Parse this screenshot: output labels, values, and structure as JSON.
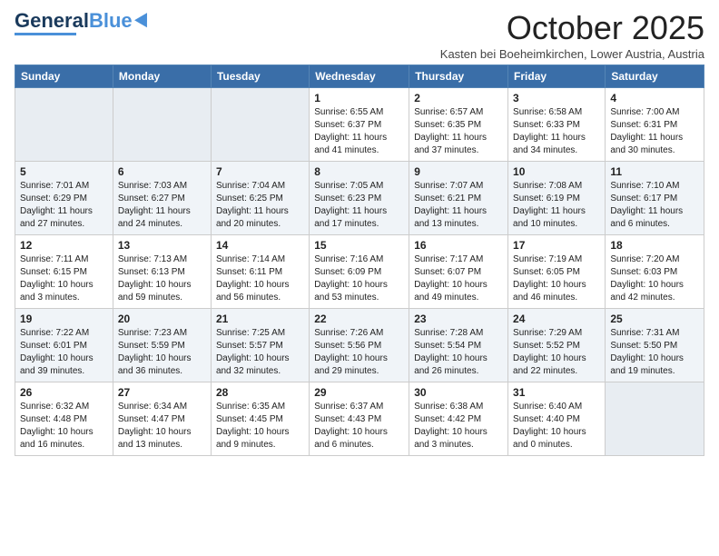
{
  "header": {
    "logo_general": "General",
    "logo_blue": "Blue",
    "month_title": "October 2025",
    "subtitle": "Kasten bei Boeheimkirchen, Lower Austria, Austria"
  },
  "days_of_week": [
    "Sunday",
    "Monday",
    "Tuesday",
    "Wednesday",
    "Thursday",
    "Friday",
    "Saturday"
  ],
  "weeks": [
    [
      {
        "day": "",
        "empty": true
      },
      {
        "day": "",
        "empty": true
      },
      {
        "day": "",
        "empty": true
      },
      {
        "day": "1",
        "sunrise": "6:55 AM",
        "sunset": "6:37 PM",
        "daylight": "11 hours and 41 minutes."
      },
      {
        "day": "2",
        "sunrise": "6:57 AM",
        "sunset": "6:35 PM",
        "daylight": "11 hours and 37 minutes."
      },
      {
        "day": "3",
        "sunrise": "6:58 AM",
        "sunset": "6:33 PM",
        "daylight": "11 hours and 34 minutes."
      },
      {
        "day": "4",
        "sunrise": "7:00 AM",
        "sunset": "6:31 PM",
        "daylight": "11 hours and 30 minutes."
      }
    ],
    [
      {
        "day": "5",
        "sunrise": "7:01 AM",
        "sunset": "6:29 PM",
        "daylight": "11 hours and 27 minutes."
      },
      {
        "day": "6",
        "sunrise": "7:03 AM",
        "sunset": "6:27 PM",
        "daylight": "11 hours and 24 minutes."
      },
      {
        "day": "7",
        "sunrise": "7:04 AM",
        "sunset": "6:25 PM",
        "daylight": "11 hours and 20 minutes."
      },
      {
        "day": "8",
        "sunrise": "7:05 AM",
        "sunset": "6:23 PM",
        "daylight": "11 hours and 17 minutes."
      },
      {
        "day": "9",
        "sunrise": "7:07 AM",
        "sunset": "6:21 PM",
        "daylight": "11 hours and 13 minutes."
      },
      {
        "day": "10",
        "sunrise": "7:08 AM",
        "sunset": "6:19 PM",
        "daylight": "11 hours and 10 minutes."
      },
      {
        "day": "11",
        "sunrise": "7:10 AM",
        "sunset": "6:17 PM",
        "daylight": "11 hours and 6 minutes."
      }
    ],
    [
      {
        "day": "12",
        "sunrise": "7:11 AM",
        "sunset": "6:15 PM",
        "daylight": "10 hours and 3 minutes."
      },
      {
        "day": "13",
        "sunrise": "7:13 AM",
        "sunset": "6:13 PM",
        "daylight": "10 hours and 59 minutes."
      },
      {
        "day": "14",
        "sunrise": "7:14 AM",
        "sunset": "6:11 PM",
        "daylight": "10 hours and 56 minutes."
      },
      {
        "day": "15",
        "sunrise": "7:16 AM",
        "sunset": "6:09 PM",
        "daylight": "10 hours and 53 minutes."
      },
      {
        "day": "16",
        "sunrise": "7:17 AM",
        "sunset": "6:07 PM",
        "daylight": "10 hours and 49 minutes."
      },
      {
        "day": "17",
        "sunrise": "7:19 AM",
        "sunset": "6:05 PM",
        "daylight": "10 hours and 46 minutes."
      },
      {
        "day": "18",
        "sunrise": "7:20 AM",
        "sunset": "6:03 PM",
        "daylight": "10 hours and 42 minutes."
      }
    ],
    [
      {
        "day": "19",
        "sunrise": "7:22 AM",
        "sunset": "6:01 PM",
        "daylight": "10 hours and 39 minutes."
      },
      {
        "day": "20",
        "sunrise": "7:23 AM",
        "sunset": "5:59 PM",
        "daylight": "10 hours and 36 minutes."
      },
      {
        "day": "21",
        "sunrise": "7:25 AM",
        "sunset": "5:57 PM",
        "daylight": "10 hours and 32 minutes."
      },
      {
        "day": "22",
        "sunrise": "7:26 AM",
        "sunset": "5:56 PM",
        "daylight": "10 hours and 29 minutes."
      },
      {
        "day": "23",
        "sunrise": "7:28 AM",
        "sunset": "5:54 PM",
        "daylight": "10 hours and 26 minutes."
      },
      {
        "day": "24",
        "sunrise": "7:29 AM",
        "sunset": "5:52 PM",
        "daylight": "10 hours and 22 minutes."
      },
      {
        "day": "25",
        "sunrise": "7:31 AM",
        "sunset": "5:50 PM",
        "daylight": "10 hours and 19 minutes."
      }
    ],
    [
      {
        "day": "26",
        "sunrise": "6:32 AM",
        "sunset": "4:48 PM",
        "daylight": "10 hours and 16 minutes."
      },
      {
        "day": "27",
        "sunrise": "6:34 AM",
        "sunset": "4:47 PM",
        "daylight": "10 hours and 13 minutes."
      },
      {
        "day": "28",
        "sunrise": "6:35 AM",
        "sunset": "4:45 PM",
        "daylight": "10 hours and 9 minutes."
      },
      {
        "day": "29",
        "sunrise": "6:37 AM",
        "sunset": "4:43 PM",
        "daylight": "10 hours and 6 minutes."
      },
      {
        "day": "30",
        "sunrise": "6:38 AM",
        "sunset": "4:42 PM",
        "daylight": "10 hours and 3 minutes."
      },
      {
        "day": "31",
        "sunrise": "6:40 AM",
        "sunset": "4:40 PM",
        "daylight": "10 hours and 0 minutes."
      },
      {
        "day": "",
        "empty": true
      }
    ]
  ]
}
